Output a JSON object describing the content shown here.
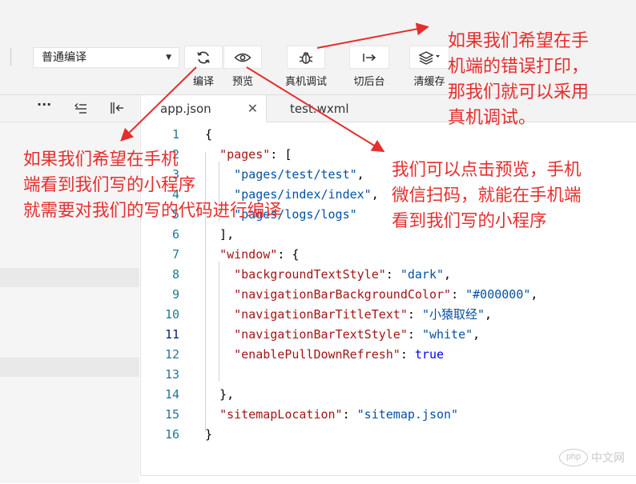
{
  "toolbar": {
    "mode_select": "普通编译",
    "compile_label": "编译",
    "preview_label": "预览",
    "device_debug_label": "真机调试",
    "background_label": "切后台",
    "clear_cache_label": "清缓存"
  },
  "tabs": [
    {
      "label": "app.json",
      "active": true
    },
    {
      "label": "test.wxml",
      "active": false
    }
  ],
  "code": {
    "lines": [
      {
        "n": "1",
        "t": "{"
      },
      {
        "n": "2",
        "t": "  \"pages\": ["
      },
      {
        "n": "3",
        "t": "    \"pages/test/test\","
      },
      {
        "n": "4",
        "t": "    \"pages/index/index\","
      },
      {
        "n": "5",
        "t": "    \"pages/logs/logs\""
      },
      {
        "n": "6",
        "t": "  ],"
      },
      {
        "n": "7",
        "t": "  \"window\": {"
      },
      {
        "n": "8",
        "t": "    \"backgroundTextStyle\": \"dark\","
      },
      {
        "n": "9",
        "t": "    \"navigationBarBackgroundColor\": \"#000000\","
      },
      {
        "n": "10",
        "t": "    \"navigationBarTitleText\": \"小猿取经\","
      },
      {
        "n": "11",
        "t": "    \"navigationBarTextStyle\": \"white\","
      },
      {
        "n": "12",
        "t": "    \"enablePullDownRefresh\": true"
      },
      {
        "n": "13",
        "t": ""
      },
      {
        "n": "14",
        "t": "  },"
      },
      {
        "n": "15",
        "t": "  \"sitemapLocation\": \"sitemap.json\""
      },
      {
        "n": "16",
        "t": "}"
      }
    ],
    "current_line": "11"
  },
  "annotations": {
    "device_debug": [
      "如果我们希望在手",
      "机端的错误打印，",
      "那我们就可以采用",
      "真机调试。"
    ],
    "compile": [
      "如果我们希望在手机",
      "端看到我们写的小程序",
      "就需要对我们的写的代码进行编译"
    ],
    "preview": [
      "我们可以点击预览，手机",
      "微信扫码，就能在手机端",
      "看到我们写的小程序"
    ]
  },
  "watermark": {
    "badge": "php",
    "text": "中文网"
  },
  "colors": {
    "annotation": "#e52e2e",
    "line_number": "#237893",
    "json_key": "#a31515",
    "json_string": "#0451a5",
    "json_keyword": "#0000ff"
  },
  "icons": {
    "compile": "refresh-icon",
    "preview": "eye-icon",
    "device_debug": "bug-icon",
    "background": "switch-background-icon",
    "clear_cache": "layers-icon"
  }
}
